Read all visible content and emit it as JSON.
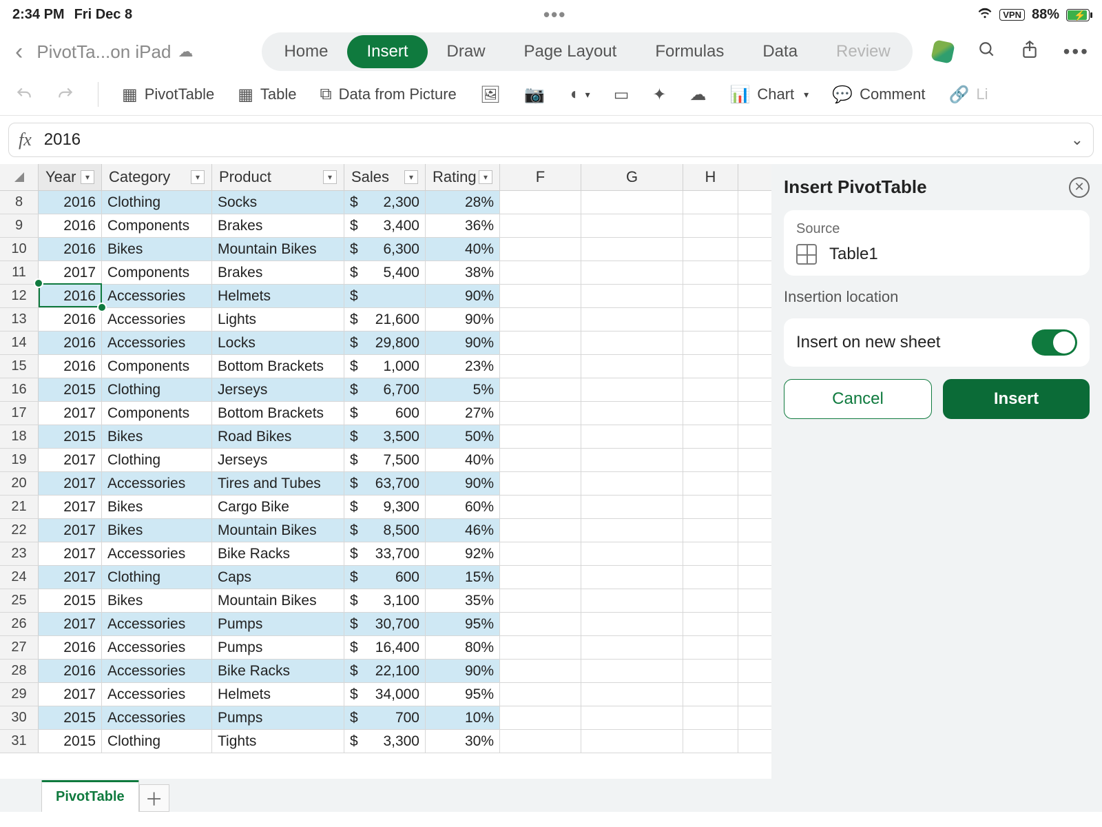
{
  "status": {
    "time": "2:34 PM",
    "date": "Fri Dec 8",
    "vpn": "VPN",
    "battery_pct": "88%"
  },
  "doc": {
    "title": "PivotTa...on iPad"
  },
  "tabs": {
    "home": "Home",
    "insert": "Insert",
    "draw": "Draw",
    "page_layout": "Page Layout",
    "formulas": "Formulas",
    "data": "Data",
    "review": "Review"
  },
  "ribbon": {
    "pivot": "PivotTable",
    "table": "Table",
    "datapic": "Data from Picture",
    "chart": "Chart",
    "comment": "Comment",
    "link": "Li"
  },
  "formula": {
    "fx": "fx",
    "value": "2016"
  },
  "columns": {
    "A": "Year",
    "B": "Category",
    "C": "Product",
    "D": "Sales",
    "E": "Rating",
    "F": "F",
    "G": "G",
    "H": "H"
  },
  "rows": [
    {
      "n": "8",
      "year": "2016",
      "cat": "Clothing",
      "prod": "Socks",
      "sales": "2,300",
      "rating": "28%",
      "alt": true
    },
    {
      "n": "9",
      "year": "2016",
      "cat": "Components",
      "prod": "Brakes",
      "sales": "3,400",
      "rating": "36%",
      "alt": false
    },
    {
      "n": "10",
      "year": "2016",
      "cat": "Bikes",
      "prod": "Mountain Bikes",
      "sales": "6,300",
      "rating": "40%",
      "alt": true
    },
    {
      "n": "11",
      "year": "2017",
      "cat": "Components",
      "prod": "Brakes",
      "sales": "5,400",
      "rating": "38%",
      "alt": false
    },
    {
      "n": "12",
      "year": "2016",
      "cat": "Accessories",
      "prod": "Helmets",
      "sales": "",
      "rating": "90%",
      "alt": true
    },
    {
      "n": "13",
      "year": "2016",
      "cat": "Accessories",
      "prod": "Lights",
      "sales": "21,600",
      "rating": "90%",
      "alt": false
    },
    {
      "n": "14",
      "year": "2016",
      "cat": "Accessories",
      "prod": "Locks",
      "sales": "29,800",
      "rating": "90%",
      "alt": true
    },
    {
      "n": "15",
      "year": "2016",
      "cat": "Components",
      "prod": "Bottom Brackets",
      "sales": "1,000",
      "rating": "23%",
      "alt": false
    },
    {
      "n": "16",
      "year": "2015",
      "cat": "Clothing",
      "prod": "Jerseys",
      "sales": "6,700",
      "rating": "5%",
      "alt": true
    },
    {
      "n": "17",
      "year": "2017",
      "cat": "Components",
      "prod": "Bottom Brackets",
      "sales": "600",
      "rating": "27%",
      "alt": false
    },
    {
      "n": "18",
      "year": "2015",
      "cat": "Bikes",
      "prod": "Road Bikes",
      "sales": "3,500",
      "rating": "50%",
      "alt": true
    },
    {
      "n": "19",
      "year": "2017",
      "cat": "Clothing",
      "prod": "Jerseys",
      "sales": "7,500",
      "rating": "40%",
      "alt": false
    },
    {
      "n": "20",
      "year": "2017",
      "cat": "Accessories",
      "prod": "Tires and Tubes",
      "sales": "63,700",
      "rating": "90%",
      "alt": true
    },
    {
      "n": "21",
      "year": "2017",
      "cat": "Bikes",
      "prod": "Cargo Bike",
      "sales": "9,300",
      "rating": "60%",
      "alt": false
    },
    {
      "n": "22",
      "year": "2017",
      "cat": "Bikes",
      "prod": "Mountain Bikes",
      "sales": "8,500",
      "rating": "46%",
      "alt": true
    },
    {
      "n": "23",
      "year": "2017",
      "cat": "Accessories",
      "prod": "Bike Racks",
      "sales": "33,700",
      "rating": "92%",
      "alt": false
    },
    {
      "n": "24",
      "year": "2017",
      "cat": "Clothing",
      "prod": "Caps",
      "sales": "600",
      "rating": "15%",
      "alt": true
    },
    {
      "n": "25",
      "year": "2015",
      "cat": "Bikes",
      "prod": "Mountain Bikes",
      "sales": "3,100",
      "rating": "35%",
      "alt": false
    },
    {
      "n": "26",
      "year": "2017",
      "cat": "Accessories",
      "prod": "Pumps",
      "sales": "30,700",
      "rating": "95%",
      "alt": true
    },
    {
      "n": "27",
      "year": "2016",
      "cat": "Accessories",
      "prod": "Pumps",
      "sales": "16,400",
      "rating": "80%",
      "alt": false
    },
    {
      "n": "28",
      "year": "2016",
      "cat": "Accessories",
      "prod": "Bike Racks",
      "sales": "22,100",
      "rating": "90%",
      "alt": true
    },
    {
      "n": "29",
      "year": "2017",
      "cat": "Accessories",
      "prod": "Helmets",
      "sales": "34,000",
      "rating": "95%",
      "alt": false
    },
    {
      "n": "30",
      "year": "2015",
      "cat": "Accessories",
      "prod": "Pumps",
      "sales": "700",
      "rating": "10%",
      "alt": true
    },
    {
      "n": "31",
      "year": "2015",
      "cat": "Clothing",
      "prod": "Tights",
      "sales": "3,300",
      "rating": "30%",
      "alt": false
    }
  ],
  "panel": {
    "title": "Insert PivotTable",
    "source_label": "Source",
    "source_name": "Table1",
    "location_label": "Insertion location",
    "new_sheet": "Insert on new sheet",
    "cancel": "Cancel",
    "insert": "Insert"
  },
  "sheet_tab": "PivotTable"
}
